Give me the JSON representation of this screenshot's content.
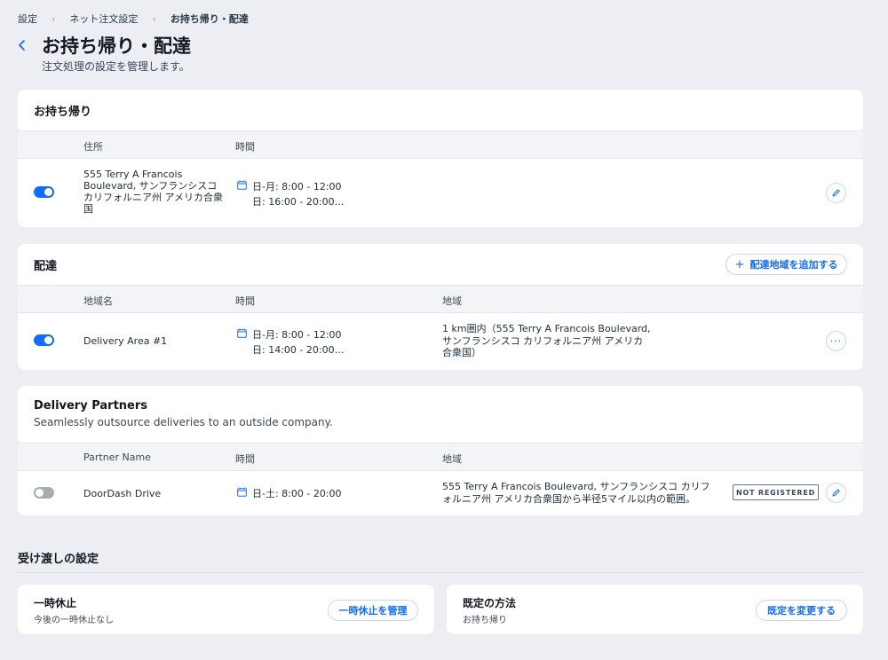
{
  "breadcrumb": {
    "item1": "設定",
    "item2": "ネット注文設定",
    "current": "お持ち帰り・配達"
  },
  "header": {
    "title": "お持ち帰り・配達",
    "subtitle": "注文処理の設定を管理します。"
  },
  "pickup": {
    "title": "お持ち帰り",
    "columns": {
      "address": "住所",
      "time": "時間"
    },
    "row": {
      "enabled": true,
      "address_lines": [
        "555 Terry A Francois",
        "Boulevard, サンフランシスコ",
        "カリフォルニア州 アメリカ合衆",
        "国"
      ],
      "time_lines": [
        "日-月: 8:00 - 12:00",
        "日: 16:00 - 20:00…"
      ]
    }
  },
  "delivery": {
    "title": "配達",
    "add_button": "配達地域を追加する",
    "columns": {
      "area_name": "地域名",
      "time": "時間",
      "region": "地域"
    },
    "row": {
      "enabled": true,
      "name": "Delivery Area #1",
      "time_lines": [
        "日-月: 8:00 - 12:00",
        "日: 14:00 - 20:00…"
      ],
      "region_lines": [
        "1 km圏内（555 Terry A Francois Boulevard,",
        "サンフランシスコ カリフォルニア州 アメリカ",
        "合衆国）"
      ]
    }
  },
  "partners": {
    "title": "Delivery Partners",
    "subtitle": "Seamlessly outsource deliveries to an outside company.",
    "columns": {
      "partner_name": "Partner Name",
      "time": "時間",
      "region": "地域"
    },
    "row": {
      "enabled": false,
      "name": "DoorDash Drive",
      "time": "日-土: 8:00 - 20:00",
      "region_lines": [
        "555 Terry A Francois Boulevard, サンフランシスコ カリフ",
        "ォルニア州 アメリカ合衆国から半径5マイル以内の範囲。"
      ],
      "status": "NOT REGISTERED"
    }
  },
  "handoff": {
    "title": "受け渡しの設定",
    "pause": {
      "title": "一時休止",
      "subtitle": "今後の一時休止なし",
      "button": "一時休止を管理"
    },
    "default_method": {
      "title": "既定の方法",
      "subtitle": "お持ち帰り",
      "button": "既定を変更する"
    }
  },
  "colors": {
    "accent": "#116dff",
    "background": "#eceef3",
    "toggle_off": "#a6acb4"
  }
}
